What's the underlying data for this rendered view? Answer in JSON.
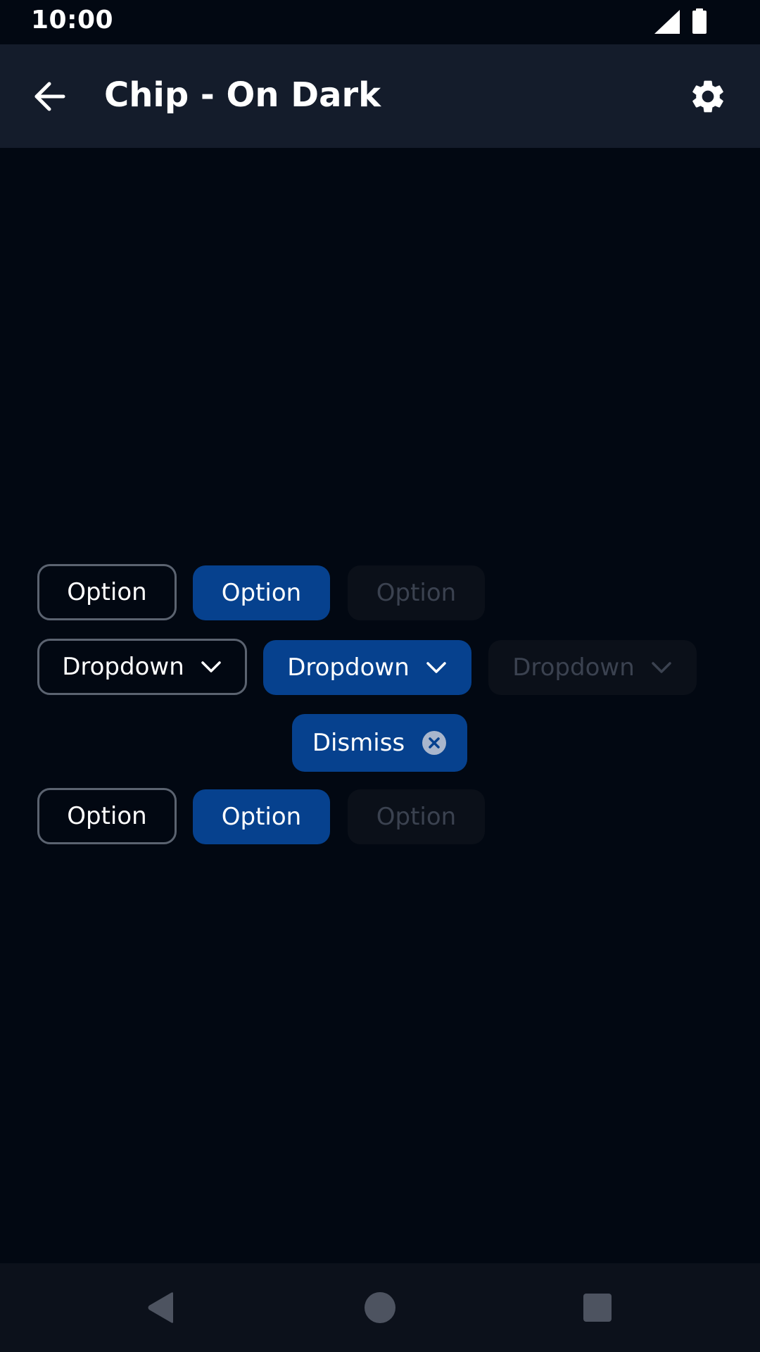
{
  "status_bar": {
    "time": "10:00",
    "icons": [
      "signal-icon",
      "battery-icon"
    ]
  },
  "app_bar": {
    "title": "Chip - On Dark",
    "back_icon": "arrow-back-icon",
    "settings_icon": "gear-icon"
  },
  "chips": {
    "row1": {
      "outlined_label": "Option",
      "selected_label": "Option",
      "disabled_label": "Option"
    },
    "row2": {
      "outlined_label": "Dropdown",
      "selected_label": "Dropdown",
      "disabled_label": "Dropdown",
      "icon": "chevron-down-icon"
    },
    "row3": {
      "dismiss_label": "Dismiss",
      "icon": "close-circle-icon"
    },
    "row4": {
      "outlined_label": "Option",
      "selected_label": "Option",
      "disabled_label": "Option"
    }
  },
  "nav_bar": {
    "icons": [
      "nav-back-icon",
      "nav-home-icon",
      "nav-recents-icon"
    ]
  },
  "colors": {
    "background": "#020812",
    "app_bar": "#141c2b",
    "chip_selected": "#06418e",
    "chip_outline": "#5b6370",
    "chip_disabled_bg": "#0b1019",
    "chip_disabled_text": "#3b4250",
    "nav_bar": "#0c111b"
  }
}
